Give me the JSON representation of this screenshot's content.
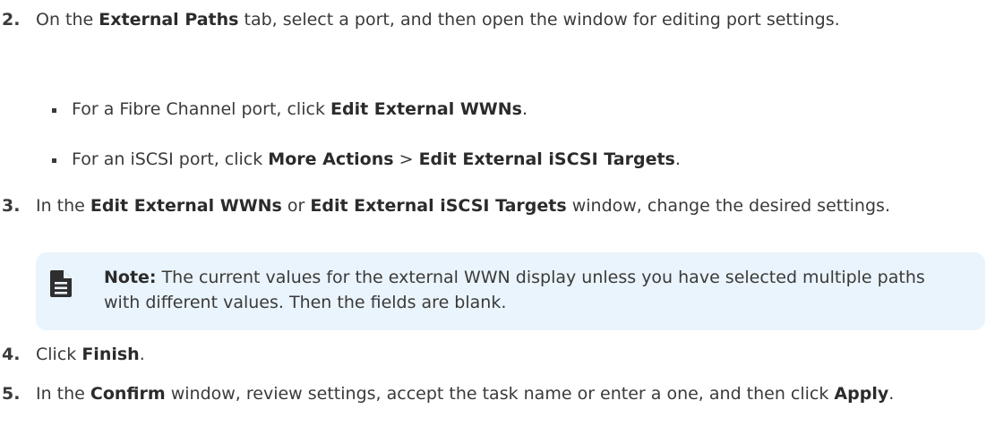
{
  "steps": {
    "s2": {
      "num": "2.",
      "parts": [
        "On the ",
        "External Paths",
        " tab, select a port, and then open the window for editing port settings."
      ]
    },
    "bullets": [
      {
        "parts": [
          "For a Fibre Channel port, click ",
          "Edit External WWNs",
          "."
        ]
      },
      {
        "parts": [
          "For an iSCSI port, click ",
          "More Actions",
          " > ",
          "Edit External iSCSI Targets",
          "."
        ]
      }
    ],
    "s3": {
      "num": "3.",
      "parts": [
        "In the ",
        "Edit External WWNs",
        " or ",
        "Edit External iSCSI Targets",
        " window, change the desired settings."
      ]
    },
    "s4": {
      "num": "4.",
      "parts": [
        "Click ",
        "Finish",
        "."
      ]
    },
    "s5": {
      "num": "5.",
      "parts": [
        "In the ",
        "Confirm",
        " window, review settings, accept the task name or enter a one, and then click ",
        "Apply",
        "."
      ]
    }
  },
  "note": {
    "icon": "document-note-icon",
    "label": "Note:",
    "text": " The current values for the external WWN display unless you have selected multiple paths with different values. Then the fields are blank."
  },
  "colors": {
    "text": "#3a3a3a",
    "note_background": "#eaf4fc"
  }
}
